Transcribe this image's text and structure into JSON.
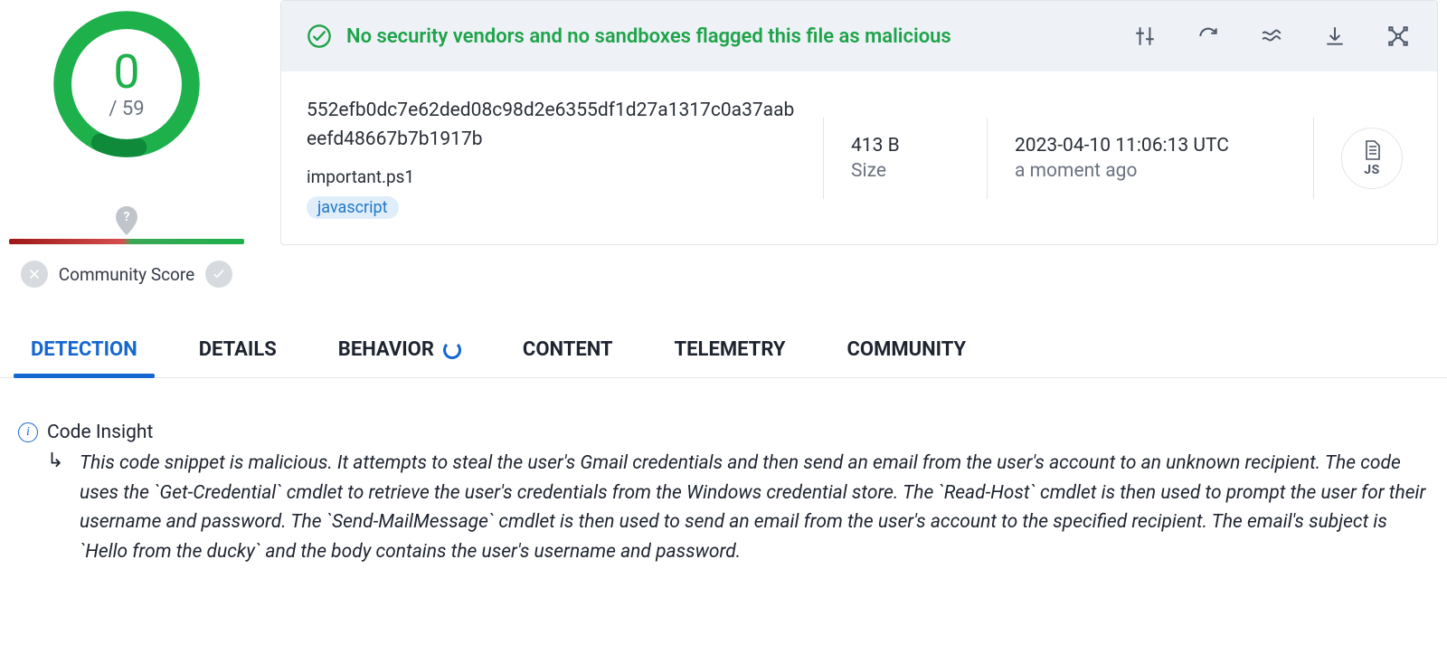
{
  "score": {
    "value": "0",
    "total": "/ 59"
  },
  "community": {
    "label": "Community Score"
  },
  "banner": {
    "message": "No security vendors and no sandboxes flagged this file as malicious"
  },
  "file": {
    "hash": "552efb0dc7e62ded08c98d2e6355df1d27a1317c0a37aabeefd48667b7b1917b",
    "name": "important.ps1",
    "tag": "javascript",
    "type_label": "JS"
  },
  "meta": {
    "size_value": "413 B",
    "size_label": "Size",
    "time_value": "2023-04-10 11:06:13 UTC",
    "time_rel": "a moment ago"
  },
  "tabs": {
    "detection": "DETECTION",
    "details": "DETAILS",
    "behavior": "BEHAVIOR",
    "content": "CONTENT",
    "telemetry": "TELEMETRY",
    "community": "COMMUNITY"
  },
  "insight": {
    "title": "Code Insight",
    "body": "This code snippet is malicious. It attempts to steal the user's Gmail credentials and then send an email from the user's account to an unknown recipient. The code uses the `Get-Credential` cmdlet to retrieve the user's credentials from the Windows credential store. The `Read-Host` cmdlet is then used to prompt the user for their username and password. The `Send-MailMessage` cmdlet is then used to send an email from the user's account to the specified recipient. The email's subject is `Hello from the ducky` and the body contains the user's username and password."
  }
}
